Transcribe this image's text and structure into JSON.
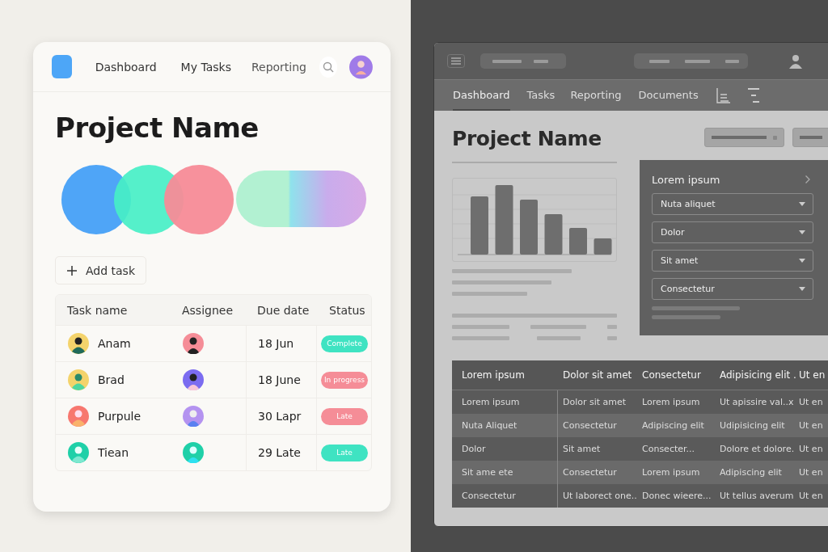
{
  "light_app": {
    "nav": [
      {
        "label": "Dashboard",
        "selected": false
      },
      {
        "label": "My Tasks",
        "selected": false
      },
      {
        "label": "Reporting",
        "selected": false
      }
    ],
    "title": "Project Name",
    "add_button": "Add task",
    "table": {
      "columns": [
        "Task name",
        "Assignee",
        "Due date",
        "Status"
      ],
      "rows": [
        {
          "task": "Anam",
          "due": "18 Jun",
          "status": "Complete",
          "color": "#3fe3c2"
        },
        {
          "task": "Brad",
          "due": "18 June",
          "status": "In progress",
          "color": "#f58d97"
        },
        {
          "task": "Purpule",
          "due": "30 Lapr",
          "status": "Late",
          "color": "#f58d97"
        },
        {
          "task": "Tiean",
          "due": "29 Late",
          "status": "Late",
          "color": "#3fe3c2"
        }
      ]
    }
  },
  "dark_app": {
    "nav": [
      {
        "label": "Dashboard",
        "selected": true
      },
      {
        "label": "Tasks",
        "selected": false
      },
      {
        "label": "Reporting",
        "selected": false
      },
      {
        "label": "Documents",
        "selected": false
      }
    ],
    "title": "Project Name",
    "panel": {
      "title": "Lorem ipsum",
      "dropdowns": [
        "Nuta aliquet",
        "Dolor",
        "Sit amet",
        "Consectetur"
      ]
    },
    "table": {
      "columns": [
        "Lorem ipsum",
        "Dolor sit amet",
        "Consectetur",
        "Adipisicing elit .",
        "Ut en"
      ],
      "rows": [
        [
          "Lorem ipsum",
          "Dolor sit amet",
          "Lorem ipsum",
          "Ut apissire val..x",
          "Ut en"
        ],
        [
          "Nuta Aliquet",
          "Consectetur",
          "Adipiscing elit",
          "Udipisicing elit",
          "Ut en"
        ],
        [
          "Dolor",
          "Sit amet",
          "Consecter...",
          "Dolore et dolore.",
          "Ut en"
        ],
        [
          "Sit ame ete",
          "Consectetur",
          "Lorem ipsum",
          "Adipiscing elit",
          "Ut en"
        ],
        [
          "Consectetur",
          "Ut laborect one..",
          "Donec wieere...",
          "Ut tellus averum",
          "Ut en"
        ]
      ]
    }
  }
}
